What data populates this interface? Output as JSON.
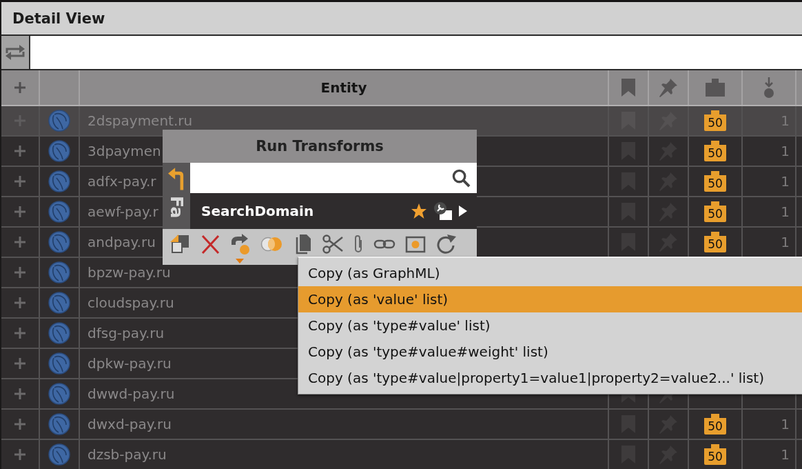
{
  "panel": {
    "title": "Detail View"
  },
  "table": {
    "columns": [
      {
        "kind": "expand"
      },
      {
        "kind": "type"
      },
      {
        "kind": "entity",
        "label": "Entity"
      },
      {
        "kind": "bookmark"
      },
      {
        "kind": "pin"
      },
      {
        "kind": "weight"
      },
      {
        "kind": "incoming"
      }
    ],
    "rows": [
      {
        "entity": "2dspayment.ru",
        "selected": true,
        "bookmarked": false,
        "pinned": false,
        "weight": "50",
        "incoming": "1"
      },
      {
        "entity": "3dpaymen",
        "selected": false,
        "bookmarked": false,
        "pinned": false,
        "weight": "50",
        "incoming": "1"
      },
      {
        "entity": "adfx-pay.r",
        "selected": false,
        "bookmarked": false,
        "pinned": false,
        "weight": "50",
        "incoming": "1"
      },
      {
        "entity": "aewf-pay.r",
        "selected": false,
        "bookmarked": false,
        "pinned": false,
        "weight": "50",
        "incoming": "1"
      },
      {
        "entity": "andpay.ru",
        "selected": false,
        "bookmarked": false,
        "pinned": false,
        "weight": "50",
        "incoming": "1"
      },
      {
        "entity": "bpzw-pay.ru",
        "selected": false
      },
      {
        "entity": "cloudspay.ru",
        "selected": false
      },
      {
        "entity": "dfsg-pay.ru",
        "selected": false
      },
      {
        "entity": "dpkw-pay.ru",
        "selected": false
      },
      {
        "entity": "dwwd-pay.ru",
        "selected": false,
        "bookmarked": false,
        "pinned": false
      },
      {
        "entity": "dwxd-pay.ru",
        "selected": false,
        "bookmarked": false,
        "pinned": false,
        "weight": "50",
        "incoming": "1"
      },
      {
        "entity": "dzsb-pay.ru",
        "selected": false,
        "bookmarked": false,
        "pinned": false,
        "weight": "50",
        "incoming": "1"
      }
    ]
  },
  "transform_popup": {
    "title": "Run Transforms",
    "side_tab": "Fa",
    "transforms": [
      {
        "name": "SearchDomain",
        "favorite": true
      }
    ]
  },
  "context_menu": {
    "items": [
      {
        "label": "Copy (as GraphML)",
        "selected": false
      },
      {
        "label": "Copy (as 'value' list)",
        "selected": true
      },
      {
        "label": "Copy (as 'type#value' list)",
        "selected": false
      },
      {
        "label": "Copy (as 'type#value#weight' list)",
        "selected": false
      },
      {
        "label": "Copy (as 'type#value|property1=value1|property2=value2...' list)",
        "selected": false
      }
    ]
  }
}
